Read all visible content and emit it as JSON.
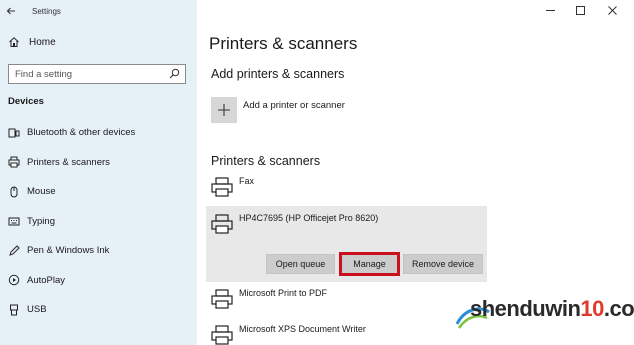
{
  "window": {
    "title": "Settings"
  },
  "sidebar": {
    "home_label": "Home",
    "search_placeholder": "Find a setting",
    "section_title": "Devices",
    "items": [
      {
        "label": "Bluetooth & other devices",
        "icon": "bluetooth-devices-icon"
      },
      {
        "label": "Printers & scanners",
        "icon": "printer-icon"
      },
      {
        "label": "Mouse",
        "icon": "mouse-icon"
      },
      {
        "label": "Typing",
        "icon": "keyboard-icon"
      },
      {
        "label": "Pen & Windows Ink",
        "icon": "pen-icon"
      },
      {
        "label": "AutoPlay",
        "icon": "autoplay-icon"
      },
      {
        "label": "USB",
        "icon": "usb-icon"
      }
    ]
  },
  "main": {
    "page_title": "Printers & scanners",
    "add_section_title": "Add printers & scanners",
    "add_label": "Add a printer or scanner",
    "list_section_title": "Printers & scanners",
    "devices": [
      {
        "name": "Fax"
      },
      {
        "name": "HP4C7695 (HP Officejet Pro 8620)"
      },
      {
        "name": "Microsoft Print to PDF"
      },
      {
        "name": "Microsoft XPS Document Writer"
      }
    ],
    "buttons": {
      "open_queue": "Open queue",
      "manage": "Manage",
      "remove_device": "Remove device"
    }
  },
  "watermark": {
    "text_a": "shenduwin",
    "text_b": "10",
    "text_c": ".com"
  },
  "colors": {
    "sidebar_bg": "#e6f0f7",
    "highlight": "#c8101e",
    "button_bg": "#cccccc"
  }
}
